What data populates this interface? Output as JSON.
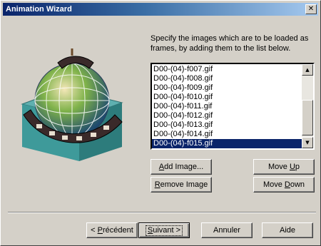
{
  "window": {
    "title": "Animation Wizard",
    "close_glyph": "✕"
  },
  "instructions": "Specify the images which are to be loaded as frames, by adding them to the list below.",
  "frames": {
    "items": [
      "D00-(04)-f007.gif",
      "D00-(04)-f008.gif",
      "D00-(04)-f009.gif",
      "D00-(04)-f010.gif",
      "D00-(04)-f011.gif",
      "D00-(04)-f012.gif",
      "D00-(04)-f013.gif",
      "D00-(04)-f014.gif",
      "D00-(04)-f015.gif"
    ],
    "selected": "D00-(04)-f015.gif"
  },
  "buttons": {
    "add_image": {
      "pre": "",
      "u": "A",
      "post": "dd Image..."
    },
    "remove_image": {
      "pre": "",
      "u": "R",
      "post": "emove Image"
    },
    "move_up": {
      "pre": "Move ",
      "u": "U",
      "post": "p"
    },
    "move_down": {
      "pre": "Move ",
      "u": "D",
      "post": "own"
    },
    "back": {
      "pre": "< ",
      "u": "P",
      "post": "récédent"
    },
    "next": {
      "pre": "",
      "u": "S",
      "post": "uivant >"
    },
    "cancel": "Annuler",
    "help": "Aide"
  },
  "icons": {
    "art": "globe-filmstrip-icon",
    "scroll_up": "▲",
    "scroll_down": "▼"
  },
  "colors": {
    "face": "#d4d0c8",
    "title_start": "#0a246a",
    "title_end": "#a6caf0",
    "selection": "#0a246a"
  }
}
